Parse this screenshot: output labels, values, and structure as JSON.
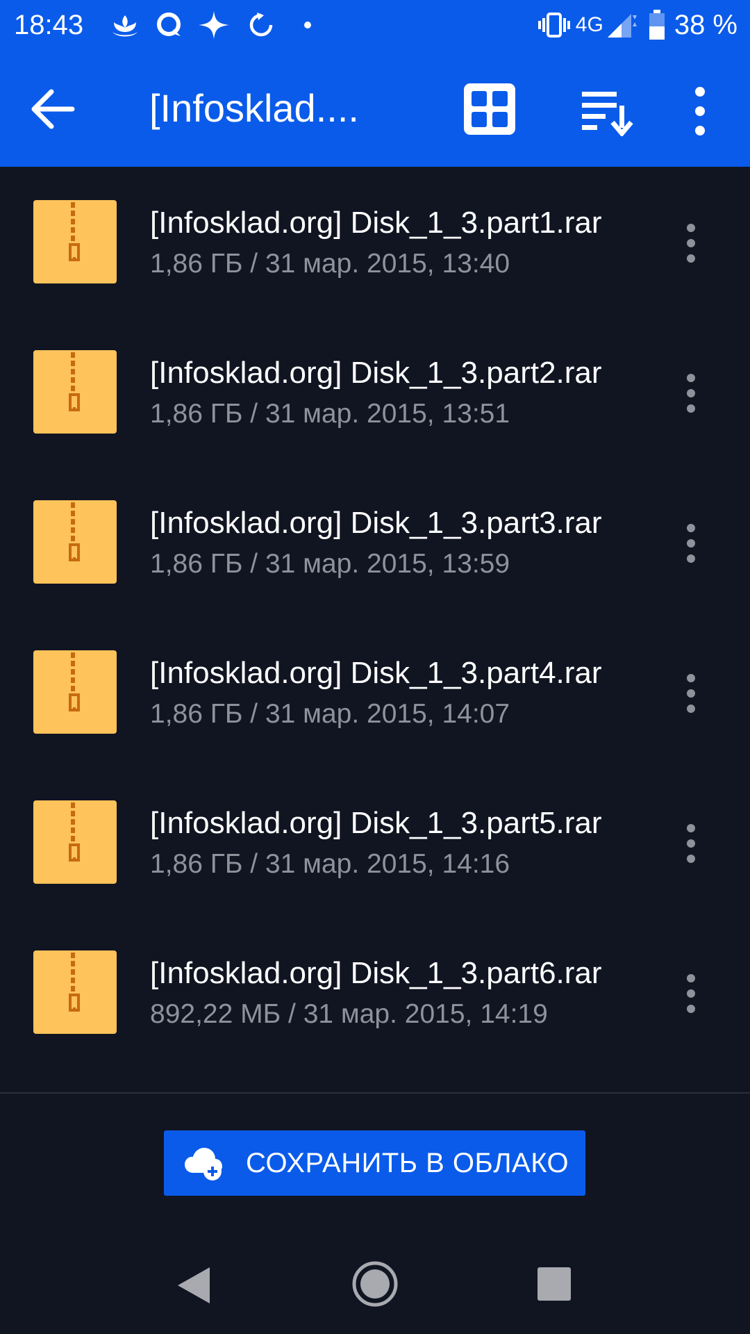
{
  "status_bar": {
    "time": "18:43",
    "network": "4G",
    "battery": "38 %",
    "icons": [
      "lotus-icon",
      "chat-bubble-icon",
      "sparkle-icon",
      "sync-icon",
      "dot-icon",
      "vibrate-icon",
      "signal-icon",
      "battery-icon"
    ]
  },
  "app_bar": {
    "title": "[Infosklad....",
    "icons": [
      "back-arrow-icon",
      "grid-view-icon",
      "sort-icon",
      "more-vert-icon"
    ]
  },
  "files": [
    {
      "name": "[Infosklad.org] Disk_1_3.part1.rar",
      "meta": "1,86 ГБ / 31 мар. 2015, 13:40"
    },
    {
      "name": "[Infosklad.org] Disk_1_3.part2.rar",
      "meta": "1,86 ГБ / 31 мар. 2015, 13:51"
    },
    {
      "name": "[Infosklad.org] Disk_1_3.part3.rar",
      "meta": "1,86 ГБ / 31 мар. 2015, 13:59"
    },
    {
      "name": "[Infosklad.org] Disk_1_3.part4.rar",
      "meta": "1,86 ГБ / 31 мар. 2015, 14:07"
    },
    {
      "name": "[Infosklad.org] Disk_1_3.part5.rar",
      "meta": "1,86 ГБ / 31 мар. 2015, 14:16"
    },
    {
      "name": "[Infosklad.org] Disk_1_3.part6.rar",
      "meta": "892,22 МБ / 31 мар. 2015, 14:19"
    }
  ],
  "save_button": {
    "label": "СОХРАНИТЬ В ОБЛАКО",
    "icon": "cloud-upload-icon"
  },
  "nav_bar": {
    "icons": [
      "nav-back-icon",
      "nav-home-icon",
      "nav-recents-icon"
    ]
  },
  "colors": {
    "primary": "#0A5BEA",
    "background": "#111522",
    "secondary_text": "#8E929B",
    "zip_icon": "#FEC35A",
    "zipper": "#C76A11"
  }
}
